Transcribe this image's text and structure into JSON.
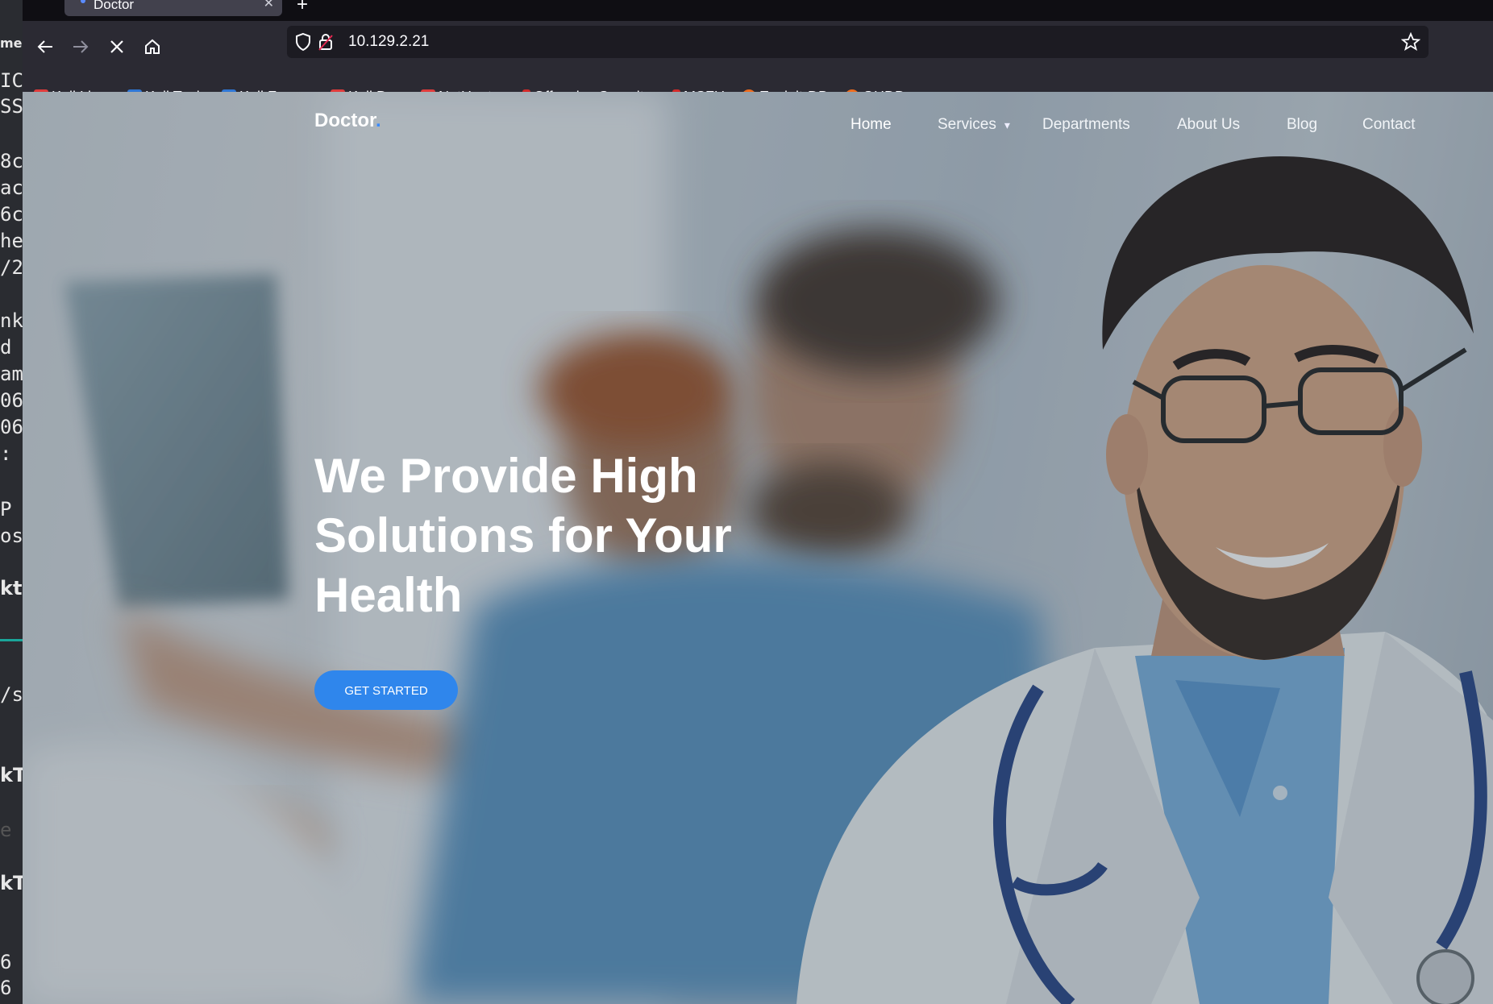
{
  "terminal": {
    "lines": [
      "me",
      "IC",
      "SS",
      "8c",
      "ac",
      "6c",
      "he",
      "/2",
      "nk",
      "d",
      "am",
      "06",
      "06",
      ":",
      "P",
      "os",
      "kt",
      "/s",
      "kT",
      "e",
      "kT",
      "6",
      "6"
    ]
  },
  "browser": {
    "tab_title": "Doctor",
    "new_tab_glyph": "+",
    "url": "10.129.2.21",
    "bookmarks": [
      {
        "label": "Kali Linux",
        "icon": "kali-dragon-icon"
      },
      {
        "label": "Kali Tools",
        "icon": "kali-tools-icon"
      },
      {
        "label": "Kali Forums",
        "icon": "kali-forums-icon"
      },
      {
        "label": "Kali Docs",
        "icon": "kali-docs-icon"
      },
      {
        "label": "NetHunter",
        "icon": "nethunter-icon"
      },
      {
        "label": "Offensive Security",
        "icon": "offsec-icon"
      },
      {
        "label": "MSFU",
        "icon": "msfu-icon"
      },
      {
        "label": "Exploit-DB",
        "icon": "exploitdb-icon"
      },
      {
        "label": "GHDB",
        "icon": "ghdb-icon"
      }
    ]
  },
  "site": {
    "logo": "Doctor",
    "logo_dot": ".",
    "nav": [
      "Home",
      "Services",
      "Departments",
      "About Us",
      "Blog",
      "Contact"
    ],
    "hero_title": "We Provide High Solutions for Your Health",
    "cta": "GET STARTED"
  },
  "colors": {
    "accent": "#2f86ec",
    "logo_dot": "#3b8cff"
  }
}
